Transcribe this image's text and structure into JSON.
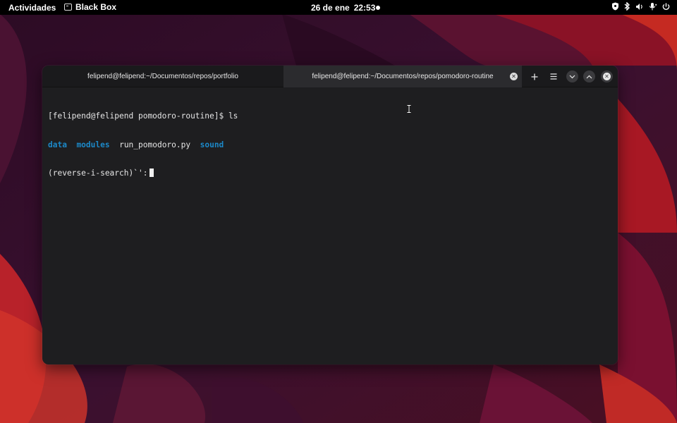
{
  "topbar": {
    "activities": "Actividades",
    "app_name": "Black Box",
    "date": "26 de ene",
    "time": "22:53"
  },
  "window": {
    "tabs": [
      {
        "title": "felipend@felipend:~/Documentos/repos/portfolio",
        "active": false
      },
      {
        "title": "felipend@felipend:~/Documentos/repos/pomodoro-routine",
        "active": true
      }
    ],
    "buttons": [
      "new-tab",
      "menu",
      "minimize",
      "maximize",
      "close"
    ]
  },
  "terminal": {
    "prompt": "[felipend@felipend pomodoro-routine]$ ls",
    "ls_items": [
      {
        "name": "data",
        "type": "dir"
      },
      {
        "name": "modules",
        "type": "dir"
      },
      {
        "name": "run_pomodoro.py",
        "type": "file"
      },
      {
        "name": "sound",
        "type": "dir"
      }
    ],
    "search_line": "(reverse-i-search)`':"
  },
  "colors": {
    "directory": "#1c88c7",
    "terminal_bg": "#1e1e20",
    "topbar_bg": "#000000"
  }
}
